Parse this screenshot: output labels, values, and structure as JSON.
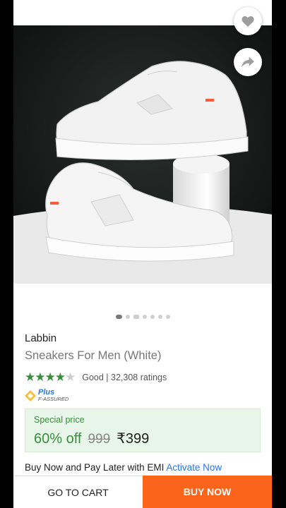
{
  "product": {
    "brand": "Labbin",
    "title": "Sneakers For Men (White)",
    "rating_stars_filled": 4,
    "rating_text": "Good | 32,308 ratings",
    "assured": {
      "line1": "Plus",
      "line2": "F-ASSURED"
    },
    "price": {
      "label": "Special price",
      "discount": "60% off",
      "mrp": "999",
      "final": "₹399"
    },
    "emi": {
      "text": "Buy Now and Pay Later with EMI",
      "link": "Activate Now"
    }
  },
  "image_carousel": {
    "count": 7,
    "active_index": 0,
    "video_index": 2
  },
  "actions": {
    "cart_label": "GO TO CART",
    "buy_label": "BUY NOW"
  },
  "colors": {
    "accent_green": "#388e3c",
    "buy_orange": "#fb641b",
    "link_blue": "#2874f0"
  },
  "icons": [
    "heart-icon",
    "share-icon",
    "star-icon",
    "plus-assured-icon"
  ]
}
